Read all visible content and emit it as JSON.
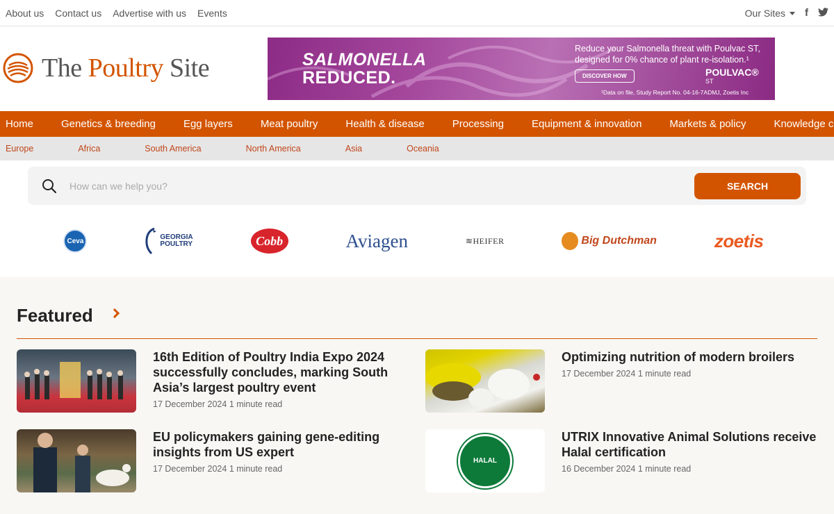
{
  "topbar": {
    "links": [
      "About us",
      "Contact us",
      "Advertise with us",
      "Events"
    ],
    "our_sites": "Our Sites",
    "facebook": "f",
    "twitter": "t"
  },
  "logo": {
    "word1": "The",
    "word2": "Poultry",
    "word3": "Site"
  },
  "banner": {
    "headline1": "SALMONELLA",
    "headline2": "REDUCED.",
    "copy_line1": "Reduce your Salmonella threat with Poulvac ST,",
    "copy_line2": "designed for 0% chance of plant re-isolation.¹",
    "cta": "DISCOVER HOW",
    "brand": "POULVAC®",
    "brand_sub": "ST",
    "footnote": "¹Data on file, Study Report No. 04-16-7ADMJ, Zoetis Inc"
  },
  "main_nav": [
    "Home",
    "Genetics & breeding",
    "Egg layers",
    "Meat poultry",
    "Health & disease",
    "Processing",
    "Equipment & innovation",
    "Markets & policy",
    "Knowledge centre"
  ],
  "region_nav": [
    "Europe",
    "Africa",
    "South America",
    "North America",
    "Asia",
    "Oceania"
  ],
  "search": {
    "placeholder": "How can we help you?",
    "button": "SEARCH"
  },
  "partners": {
    "ceva": "Ceva",
    "georgia_1": "GEORGIA",
    "georgia_2": "POULTRY",
    "cobb": "Cobb",
    "aviagen": "Aviagen",
    "heifer": "HEIFER",
    "bigdutchman": "Big Dutchman",
    "zoetis": "zoetis"
  },
  "featured": {
    "title": "Featured",
    "articles": [
      {
        "title": "16th Edition of Poultry India Expo 2024 successfully concludes, marking South Asia’s largest poultry event",
        "date": "17 December 2024",
        "read": "1 minute read"
      },
      {
        "title": "Optimizing nutrition of modern broilers",
        "date": "17 December 2024",
        "read": "1 minute read"
      },
      {
        "title": "EU policymakers gaining gene-editing insights from US expert",
        "date": "17 December 2024",
        "read": "1 minute read"
      },
      {
        "title": "UTRIX Innovative Animal Solutions receive Halal certification",
        "date": "16 December 2024",
        "read": "1 minute read",
        "badge": "HALAL"
      }
    ]
  }
}
